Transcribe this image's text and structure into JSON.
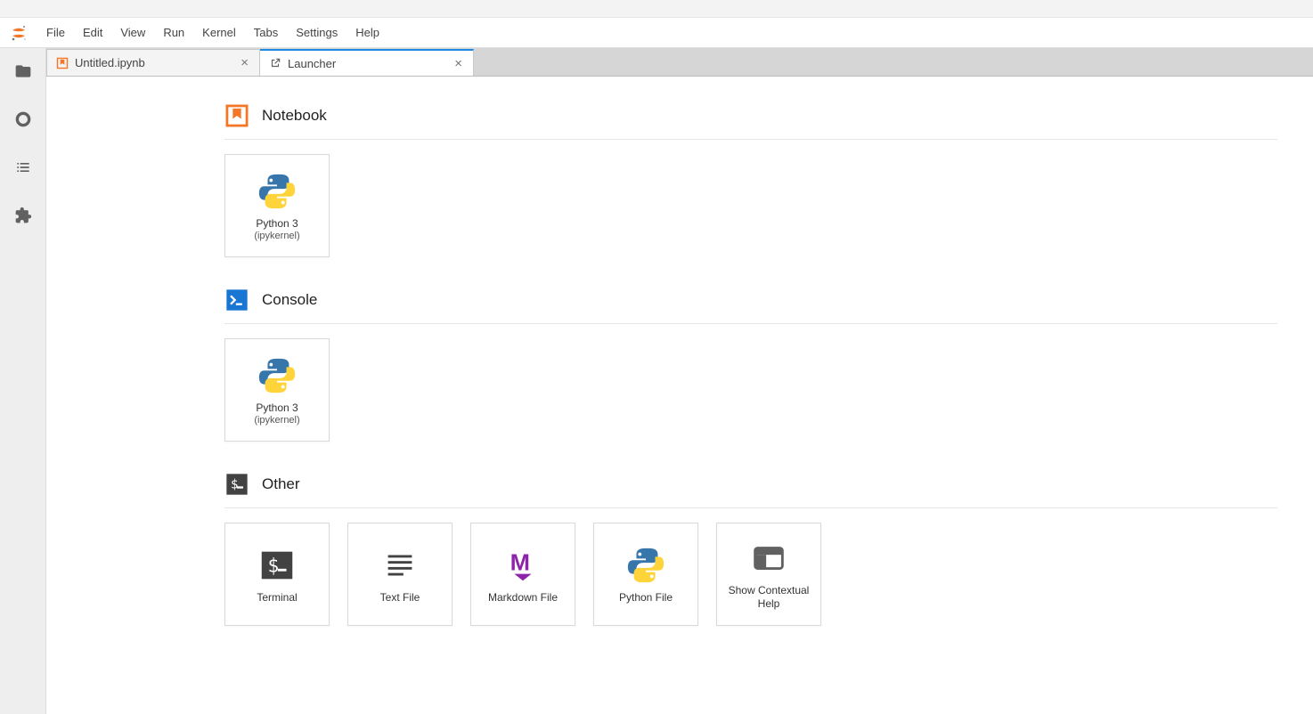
{
  "menubar": {
    "items": [
      "File",
      "Edit",
      "View",
      "Run",
      "Kernel",
      "Tabs",
      "Settings",
      "Help"
    ]
  },
  "tabs": [
    {
      "label": "Untitled.ipynb",
      "icon": "notebook",
      "active": false
    },
    {
      "label": "Launcher",
      "icon": "launcher",
      "active": true
    }
  ],
  "launcher": {
    "sections": {
      "notebook": {
        "title": "Notebook",
        "items": [
          {
            "title": "Python 3",
            "subtitle": "(ipykernel)",
            "icon": "python"
          }
        ]
      },
      "console": {
        "title": "Console",
        "items": [
          {
            "title": "Python 3",
            "subtitle": "(ipykernel)",
            "icon": "python"
          }
        ]
      },
      "other": {
        "title": "Other",
        "items": [
          {
            "title": "Terminal",
            "subtitle": "",
            "icon": "terminal"
          },
          {
            "title": "Text File",
            "subtitle": "",
            "icon": "textfile"
          },
          {
            "title": "Markdown File",
            "subtitle": "",
            "icon": "markdown"
          },
          {
            "title": "Python File",
            "subtitle": "",
            "icon": "python"
          },
          {
            "title": "Show Contextual Help",
            "subtitle": "",
            "icon": "context-help"
          }
        ]
      }
    }
  },
  "colors": {
    "accent_orange": "#f37726",
    "accent_blue": "#1e88e5",
    "console_blue": "#1976d2",
    "other_dark": "#424242",
    "markdown_purple": "#8e24aa",
    "python_blue": "#306998",
    "python_yellow": "#ffd43b"
  }
}
